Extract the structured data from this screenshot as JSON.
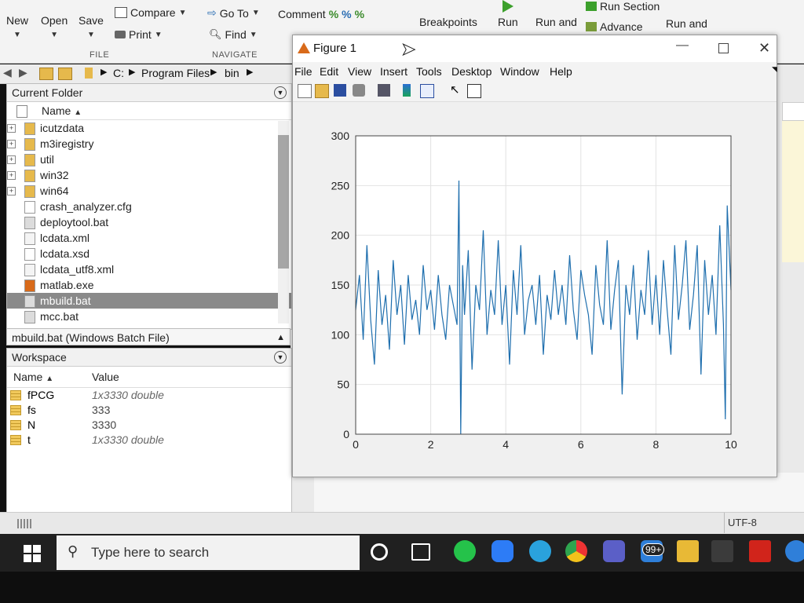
{
  "ribbon": {
    "new_label": "New",
    "open_label": "Open",
    "save_label": "Save",
    "compare_label": "Compare",
    "print_label": "Print",
    "goto_label": "Go To",
    "find_label": "Find",
    "comment_label": "Comment",
    "breakpoints_label": "Breakpoints",
    "run_label": "Run",
    "run_and_label": "Run and",
    "run_section_label": "Run Section",
    "advance_label": "Advance",
    "run_and_label2": "Run and",
    "group_file": "FILE",
    "group_navigate": "NAVIGATE"
  },
  "address": {
    "segments": [
      "C:",
      "Program Files",
      "bin"
    ]
  },
  "current_folder": {
    "title": "Current Folder",
    "column_name": "Name",
    "items": [
      {
        "name": "icutzdata",
        "kind": "folder"
      },
      {
        "name": "m3iregistry",
        "kind": "folder"
      },
      {
        "name": "util",
        "kind": "folder"
      },
      {
        "name": "win32",
        "kind": "folder"
      },
      {
        "name": "win64",
        "kind": "folder"
      },
      {
        "name": "crash_analyzer.cfg",
        "kind": "file"
      },
      {
        "name": "deploytool.bat",
        "kind": "bat"
      },
      {
        "name": "lcdata.xml",
        "kind": "xml"
      },
      {
        "name": "lcdata.xsd",
        "kind": "file"
      },
      {
        "name": "lcdata_utf8.xml",
        "kind": "xml"
      },
      {
        "name": "matlab.exe",
        "kind": "matlab"
      },
      {
        "name": "mbuild.bat",
        "kind": "bat"
      },
      {
        "name": "mcc.bat",
        "kind": "bat"
      }
    ],
    "selected_index": 11,
    "detail": "mbuild.bat  (Windows Batch File)"
  },
  "workspace": {
    "title": "Workspace",
    "col_name": "Name",
    "col_value": "Value",
    "vars": [
      {
        "name": "fPCG",
        "value": "1x3330 double"
      },
      {
        "name": "fs",
        "value": "333"
      },
      {
        "name": "N",
        "value": "3330"
      },
      {
        "name": "t",
        "value": "1x3330 double"
      }
    ]
  },
  "figure": {
    "title": "Figure 1",
    "menu": [
      "File",
      "Edit",
      "View",
      "Insert",
      "Tools",
      "Desktop",
      "Window",
      "Help"
    ]
  },
  "chart_data": {
    "type": "line",
    "title": "",
    "xlabel": "",
    "ylabel": "",
    "xlim": [
      0,
      10
    ],
    "ylim": [
      0,
      300
    ],
    "xticks": [
      0,
      2,
      4,
      6,
      8,
      10
    ],
    "yticks": [
      0,
      50,
      100,
      150,
      200,
      250,
      300
    ],
    "grid": true,
    "series_color": "#1f6fae",
    "x": [
      0.0,
      0.1,
      0.2,
      0.3,
      0.4,
      0.5,
      0.6,
      0.7,
      0.8,
      0.9,
      1.0,
      1.1,
      1.2,
      1.3,
      1.4,
      1.5,
      1.6,
      1.7,
      1.8,
      1.9,
      2.0,
      2.1,
      2.2,
      2.3,
      2.4,
      2.5,
      2.6,
      2.7,
      2.75,
      2.8,
      2.85,
      2.9,
      3.0,
      3.1,
      3.2,
      3.3,
      3.4,
      3.5,
      3.6,
      3.7,
      3.8,
      3.9,
      4.0,
      4.1,
      4.2,
      4.3,
      4.4,
      4.5,
      4.6,
      4.7,
      4.8,
      4.9,
      5.0,
      5.1,
      5.2,
      5.3,
      5.4,
      5.5,
      5.6,
      5.7,
      5.8,
      5.9,
      6.0,
      6.1,
      6.2,
      6.3,
      6.4,
      6.5,
      6.6,
      6.7,
      6.8,
      6.9,
      7.0,
      7.1,
      7.2,
      7.3,
      7.4,
      7.5,
      7.6,
      7.7,
      7.8,
      7.9,
      8.0,
      8.1,
      8.2,
      8.3,
      8.4,
      8.5,
      8.6,
      8.7,
      8.8,
      8.9,
      9.0,
      9.1,
      9.2,
      9.3,
      9.4,
      9.5,
      9.6,
      9.7,
      9.8,
      9.85,
      9.9,
      10.0
    ],
    "y": [
      125,
      160,
      95,
      190,
      115,
      70,
      165,
      110,
      140,
      85,
      175,
      120,
      150,
      90,
      160,
      115,
      135,
      100,
      170,
      125,
      145,
      105,
      160,
      120,
      95,
      150,
      130,
      110,
      255,
      0,
      170,
      120,
      185,
      65,
      150,
      125,
      205,
      100,
      145,
      120,
      195,
      110,
      150,
      70,
      165,
      120,
      190,
      100,
      135,
      150,
      110,
      160,
      80,
      140,
      115,
      165,
      120,
      150,
      110,
      180,
      125,
      95,
      165,
      140,
      120,
      80,
      170,
      130,
      110,
      195,
      105,
      145,
      175,
      40,
      150,
      120,
      170,
      95,
      145,
      120,
      185,
      110,
      160,
      100,
      175,
      125,
      80,
      190,
      115,
      150,
      195,
      105,
      140,
      190,
      60,
      175,
      120,
      160,
      100,
      210,
      110,
      15,
      230,
      145
    ]
  },
  "statusbar": {
    "encoding": "UTF-8"
  },
  "taskbar": {
    "search_placeholder": "Type here to search",
    "badge": "99+"
  },
  "colors": {
    "plot_line": "#1f6fae",
    "selection": "#8a8a8a",
    "taskbar": "#202020"
  }
}
